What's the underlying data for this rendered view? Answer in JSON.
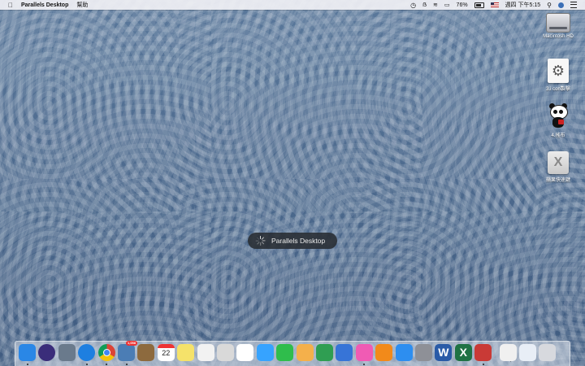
{
  "menubar": {
    "app_name": "Parallels Desktop",
    "help": "幫助",
    "battery": "76%",
    "clock": "週四 下午5:15",
    "icons": [
      "apple-icon",
      "time-machine-icon",
      "bluetooth-icon",
      "wifi-icon",
      "airplay-icon",
      "battery-icon",
      "flag-icon",
      "spotlight-icon",
      "user-icon",
      "notification-center-icon"
    ]
  },
  "desktop": {
    "items": [
      {
        "label": "Macintosh HD",
        "icon": "hard-drive-icon"
      },
      {
        "label": "3.i con製擊",
        "icon": "gear-document-icon"
      },
      {
        "label": "4.搖布",
        "icon": "panda-icon"
      },
      {
        "label": "蘋果快速鍵",
        "icon": "x-app-icon"
      }
    ]
  },
  "hud": {
    "label": "Parallels Desktop"
  },
  "dock": {
    "mail_badge": "1,058",
    "calendar_day": "22",
    "apps": [
      {
        "name": "finder",
        "color": "#2a87e6",
        "running": true
      },
      {
        "name": "siri",
        "color": "#3a2d7a",
        "running": false
      },
      {
        "name": "launchpad",
        "color": "#6a7a8c",
        "running": false
      },
      {
        "name": "safari",
        "color": "#1e7fe0",
        "running": true
      },
      {
        "name": "chrome",
        "color": "#e8e8e8",
        "running": true
      },
      {
        "name": "mail-preview",
        "color": "#4b7db5",
        "running": true
      },
      {
        "name": "notebook",
        "color": "#8d6a3e",
        "running": false
      },
      {
        "name": "calendar",
        "color": "#ffffff",
        "running": false
      },
      {
        "name": "notes",
        "color": "#f5e26a",
        "running": false
      },
      {
        "name": "reminders",
        "color": "#f2f2f2",
        "running": false
      },
      {
        "name": "photo-editor",
        "color": "#d9d9d9",
        "running": false
      },
      {
        "name": "photos",
        "color": "#ffffff",
        "running": false
      },
      {
        "name": "messages",
        "color": "#36a3ff",
        "running": false
      },
      {
        "name": "facetime",
        "color": "#2fbd4c",
        "running": false
      },
      {
        "name": "pages",
        "color": "#f4b04b",
        "running": false
      },
      {
        "name": "numbers",
        "color": "#2f9e52",
        "running": false
      },
      {
        "name": "keynote",
        "color": "#3774d7",
        "running": false
      },
      {
        "name": "itunes",
        "color": "#f05bb4",
        "running": true
      },
      {
        "name": "ibooks",
        "color": "#f28a1a",
        "running": false
      },
      {
        "name": "app-store",
        "color": "#2d8ef0",
        "running": false
      },
      {
        "name": "system-preferences",
        "color": "#8e9097",
        "running": false
      },
      {
        "name": "word",
        "color": "#2a5ba7",
        "running": false
      },
      {
        "name": "excel",
        "color": "#1f7244",
        "running": false
      },
      {
        "name": "parallels",
        "color": "#c93a36",
        "running": true
      },
      {
        "name": "document",
        "color": "#f0f0f0",
        "running": false
      },
      {
        "name": "mail-doc",
        "color": "#e8eef6",
        "running": false
      },
      {
        "name": "trash",
        "color": "#d7d9de",
        "running": false
      }
    ]
  }
}
